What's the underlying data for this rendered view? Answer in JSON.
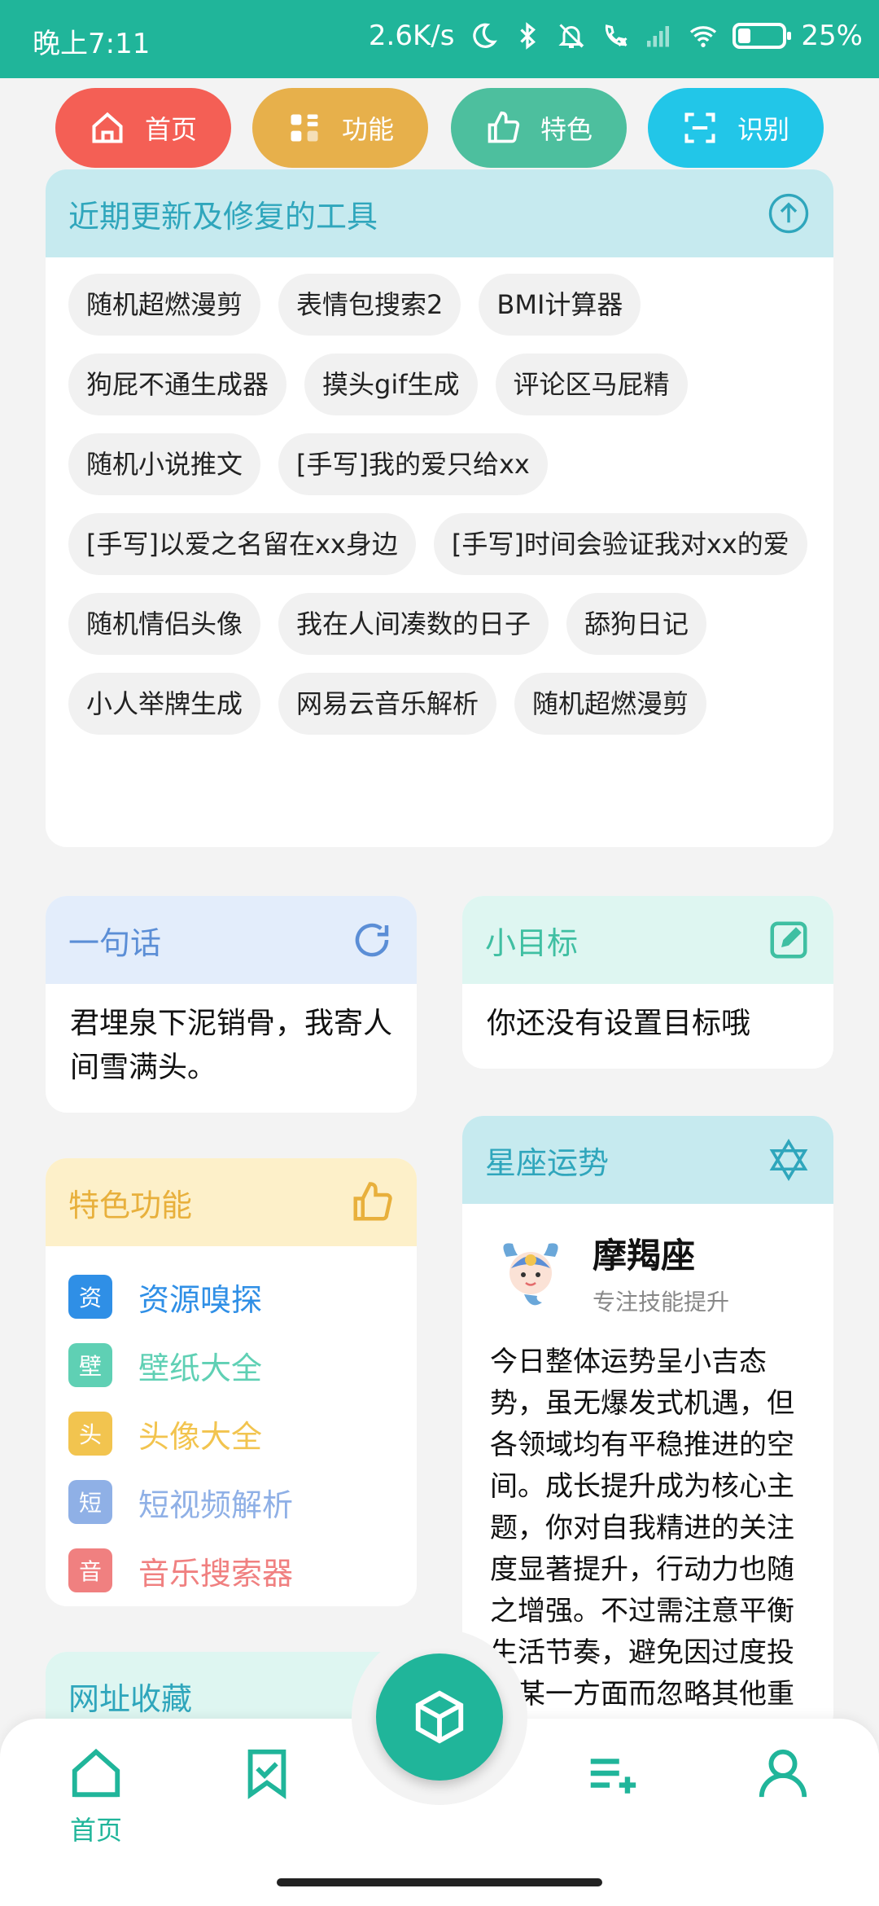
{
  "status_bar": {
    "time": "晚上7:11",
    "network_speed": "2.6K/s",
    "battery": "25%",
    "battery_level": 0.25,
    "icons": [
      "moon-icon",
      "bluetooth-icon",
      "mute-bell-icon",
      "call-off-icon",
      "signal-icon",
      "wifi-icon",
      "battery-icon"
    ]
  },
  "colors": {
    "brand": "#20b59a",
    "pill_home": "#f45f55",
    "pill_function": "#e7b04b",
    "pill_feature": "#4dbf9e",
    "pill_recognize": "#22c6e8"
  },
  "pills": [
    {
      "label": "首页",
      "icon": "home-icon"
    },
    {
      "label": "功能",
      "icon": "grid-icon"
    },
    {
      "label": "特色",
      "icon": "thumbs-up-icon"
    },
    {
      "label": "识别",
      "icon": "scan-icon"
    }
  ],
  "recent_tools": {
    "title": "近期更新及修复的工具",
    "icon": "arrow-up-circle-icon",
    "tags": [
      "随机超燃漫剪",
      "表情包搜索2",
      "BMI计算器",
      "狗屁不通生成器",
      "摸头gif生成",
      "评论区马屁精",
      "随机小说推文",
      "[手写]我的爱只给xx",
      "[手写]以爱之名留在xx身边",
      "[手写]时间会验证我对xx的爱",
      "随机情侣头像",
      "我在人间凑数的日子",
      "舔狗日记",
      "小人举牌生成",
      "网易云音乐解析",
      "随机超燃漫剪"
    ]
  },
  "quote_card": {
    "title": "一句话",
    "icon": "refresh-icon",
    "text": "君埋泉下泥销骨，我寄人间雪满头。"
  },
  "goal_card": {
    "title": "小目标",
    "icon": "edit-icon",
    "text": "你还没有设置目标哦"
  },
  "feature_card": {
    "title": "特色功能",
    "icon": "thumbs-up-icon",
    "items": [
      {
        "badge": "资",
        "label": "资源嗅探",
        "color": "#2f8fe6"
      },
      {
        "badge": "壁",
        "label": "壁纸大全",
        "color": "#5fd0b4"
      },
      {
        "badge": "头",
        "label": "头像大全",
        "color": "#f2c44f"
      },
      {
        "badge": "短",
        "label": "短视频解析",
        "color": "#8fb0e6"
      },
      {
        "badge": "音",
        "label": "音乐搜索器",
        "color": "#f08080"
      }
    ]
  },
  "horoscope_card": {
    "title": "星座运势",
    "icon": "star-of-david-icon",
    "sign": "摩羯座",
    "subtitle": "专注技能提升",
    "text": "今日整体运势呈小吉态势，虽无爆发式机遇，但各领域均有平稳推进的空间。成长提升成为核心主题，你对自我精进的关注度显著提升，行动力也随之增强。不过需注意平衡生活节奏，避免因过度投入某一方面而忽略其他重要事务，保持张弛有度才能让状态持续在线。"
  },
  "bookmark_card": {
    "title": "网址收藏",
    "icon": "plus-icon"
  },
  "bottom_nav": {
    "items": [
      {
        "label": "首页",
        "icon": "home-icon"
      },
      {
        "label": "",
        "icon": "bookmark-check-icon"
      },
      {
        "label": "",
        "icon": "playlist-add-icon"
      },
      {
        "label": "",
        "icon": "user-icon"
      }
    ],
    "fab_icon": "cube-icon"
  }
}
